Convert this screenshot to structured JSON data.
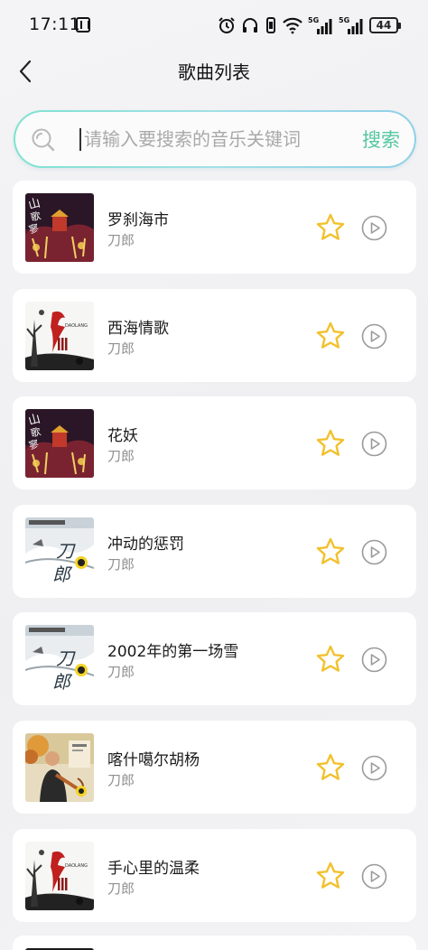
{
  "status_bar": {
    "time": "17:11",
    "network_1": "5G",
    "network_2": "5G",
    "battery": "44"
  },
  "header": {
    "title": "歌曲列表"
  },
  "search": {
    "placeholder": "请输入要搜索的音乐关键词",
    "value": "",
    "button_label": "搜索"
  },
  "songs": [
    {
      "title": "罗刹海市",
      "artist": "刀郎",
      "cover": "shange-album",
      "favorited": true
    },
    {
      "title": "西海情歌",
      "artist": "刀郎",
      "cover": "daolang-iii-album",
      "favorited": true
    },
    {
      "title": "花妖",
      "artist": "刀郎",
      "cover": "shange-album",
      "favorited": true
    },
    {
      "title": "冲动的惩罚",
      "artist": "刀郎",
      "cover": "daolang-2002-album",
      "favorited": true
    },
    {
      "title": "2002年的第一场雪",
      "artist": "刀郎",
      "cover": "daolang-2002-album",
      "favorited": true
    },
    {
      "title": "喀什噶尔胡杨",
      "artist": "刀郎",
      "cover": "kashgar-album",
      "favorited": true
    },
    {
      "title": "手心里的温柔",
      "artist": "刀郎",
      "cover": "daolang-iii-album",
      "favorited": true
    }
  ],
  "colors": {
    "accent": "#56c7a2",
    "star": "#f2c12e",
    "play": "#9a9a9a",
    "search_border_start": "#7fe2cf",
    "search_border_end": "#8fd0e8"
  }
}
